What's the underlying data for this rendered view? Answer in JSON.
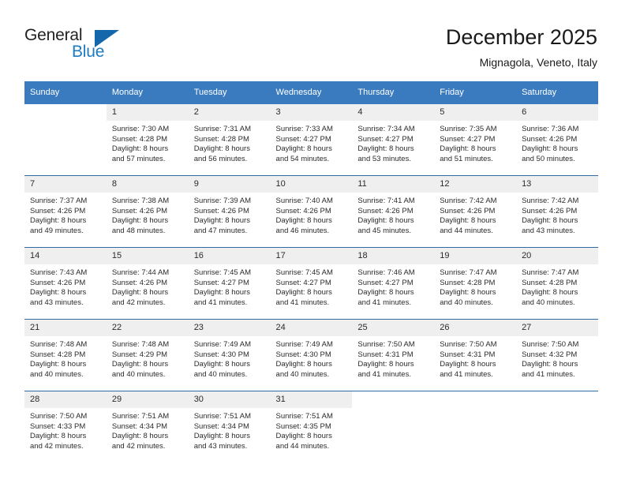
{
  "brand": {
    "name_part1": "General",
    "name_part2": "Blue",
    "triangle_color": "#1567ac",
    "blue_text_color": "#1f7ac0"
  },
  "header": {
    "title": "December 2025",
    "location": "Mignagola, Veneto, Italy"
  },
  "theme": {
    "header_row_bg": "#3a7bbf",
    "daynum_bg": "#efefef",
    "separator": "#2e6da4",
    "text": "#2b2b2b"
  },
  "weekdays": [
    "Sunday",
    "Monday",
    "Tuesday",
    "Wednesday",
    "Thursday",
    "Friday",
    "Saturday"
  ],
  "weeks": [
    [
      {
        "day": ""
      },
      {
        "day": "1",
        "sunrise": "Sunrise: 7:30 AM",
        "sunset": "Sunset: 4:28 PM",
        "daylight1": "Daylight: 8 hours",
        "daylight2": "and 57 minutes."
      },
      {
        "day": "2",
        "sunrise": "Sunrise: 7:31 AM",
        "sunset": "Sunset: 4:28 PM",
        "daylight1": "Daylight: 8 hours",
        "daylight2": "and 56 minutes."
      },
      {
        "day": "3",
        "sunrise": "Sunrise: 7:33 AM",
        "sunset": "Sunset: 4:27 PM",
        "daylight1": "Daylight: 8 hours",
        "daylight2": "and 54 minutes."
      },
      {
        "day": "4",
        "sunrise": "Sunrise: 7:34 AM",
        "sunset": "Sunset: 4:27 PM",
        "daylight1": "Daylight: 8 hours",
        "daylight2": "and 53 minutes."
      },
      {
        "day": "5",
        "sunrise": "Sunrise: 7:35 AM",
        "sunset": "Sunset: 4:27 PM",
        "daylight1": "Daylight: 8 hours",
        "daylight2": "and 51 minutes."
      },
      {
        "day": "6",
        "sunrise": "Sunrise: 7:36 AM",
        "sunset": "Sunset: 4:26 PM",
        "daylight1": "Daylight: 8 hours",
        "daylight2": "and 50 minutes."
      }
    ],
    [
      {
        "day": "7",
        "sunrise": "Sunrise: 7:37 AM",
        "sunset": "Sunset: 4:26 PM",
        "daylight1": "Daylight: 8 hours",
        "daylight2": "and 49 minutes."
      },
      {
        "day": "8",
        "sunrise": "Sunrise: 7:38 AM",
        "sunset": "Sunset: 4:26 PM",
        "daylight1": "Daylight: 8 hours",
        "daylight2": "and 48 minutes."
      },
      {
        "day": "9",
        "sunrise": "Sunrise: 7:39 AM",
        "sunset": "Sunset: 4:26 PM",
        "daylight1": "Daylight: 8 hours",
        "daylight2": "and 47 minutes."
      },
      {
        "day": "10",
        "sunrise": "Sunrise: 7:40 AM",
        "sunset": "Sunset: 4:26 PM",
        "daylight1": "Daylight: 8 hours",
        "daylight2": "and 46 minutes."
      },
      {
        "day": "11",
        "sunrise": "Sunrise: 7:41 AM",
        "sunset": "Sunset: 4:26 PM",
        "daylight1": "Daylight: 8 hours",
        "daylight2": "and 45 minutes."
      },
      {
        "day": "12",
        "sunrise": "Sunrise: 7:42 AM",
        "sunset": "Sunset: 4:26 PM",
        "daylight1": "Daylight: 8 hours",
        "daylight2": "and 44 minutes."
      },
      {
        "day": "13",
        "sunrise": "Sunrise: 7:42 AM",
        "sunset": "Sunset: 4:26 PM",
        "daylight1": "Daylight: 8 hours",
        "daylight2": "and 43 minutes."
      }
    ],
    [
      {
        "day": "14",
        "sunrise": "Sunrise: 7:43 AM",
        "sunset": "Sunset: 4:26 PM",
        "daylight1": "Daylight: 8 hours",
        "daylight2": "and 43 minutes."
      },
      {
        "day": "15",
        "sunrise": "Sunrise: 7:44 AM",
        "sunset": "Sunset: 4:26 PM",
        "daylight1": "Daylight: 8 hours",
        "daylight2": "and 42 minutes."
      },
      {
        "day": "16",
        "sunrise": "Sunrise: 7:45 AM",
        "sunset": "Sunset: 4:27 PM",
        "daylight1": "Daylight: 8 hours",
        "daylight2": "and 41 minutes."
      },
      {
        "day": "17",
        "sunrise": "Sunrise: 7:45 AM",
        "sunset": "Sunset: 4:27 PM",
        "daylight1": "Daylight: 8 hours",
        "daylight2": "and 41 minutes."
      },
      {
        "day": "18",
        "sunrise": "Sunrise: 7:46 AM",
        "sunset": "Sunset: 4:27 PM",
        "daylight1": "Daylight: 8 hours",
        "daylight2": "and 41 minutes."
      },
      {
        "day": "19",
        "sunrise": "Sunrise: 7:47 AM",
        "sunset": "Sunset: 4:28 PM",
        "daylight1": "Daylight: 8 hours",
        "daylight2": "and 40 minutes."
      },
      {
        "day": "20",
        "sunrise": "Sunrise: 7:47 AM",
        "sunset": "Sunset: 4:28 PM",
        "daylight1": "Daylight: 8 hours",
        "daylight2": "and 40 minutes."
      }
    ],
    [
      {
        "day": "21",
        "sunrise": "Sunrise: 7:48 AM",
        "sunset": "Sunset: 4:28 PM",
        "daylight1": "Daylight: 8 hours",
        "daylight2": "and 40 minutes."
      },
      {
        "day": "22",
        "sunrise": "Sunrise: 7:48 AM",
        "sunset": "Sunset: 4:29 PM",
        "daylight1": "Daylight: 8 hours",
        "daylight2": "and 40 minutes."
      },
      {
        "day": "23",
        "sunrise": "Sunrise: 7:49 AM",
        "sunset": "Sunset: 4:30 PM",
        "daylight1": "Daylight: 8 hours",
        "daylight2": "and 40 minutes."
      },
      {
        "day": "24",
        "sunrise": "Sunrise: 7:49 AM",
        "sunset": "Sunset: 4:30 PM",
        "daylight1": "Daylight: 8 hours",
        "daylight2": "and 40 minutes."
      },
      {
        "day": "25",
        "sunrise": "Sunrise: 7:50 AM",
        "sunset": "Sunset: 4:31 PM",
        "daylight1": "Daylight: 8 hours",
        "daylight2": "and 41 minutes."
      },
      {
        "day": "26",
        "sunrise": "Sunrise: 7:50 AM",
        "sunset": "Sunset: 4:31 PM",
        "daylight1": "Daylight: 8 hours",
        "daylight2": "and 41 minutes."
      },
      {
        "day": "27",
        "sunrise": "Sunrise: 7:50 AM",
        "sunset": "Sunset: 4:32 PM",
        "daylight1": "Daylight: 8 hours",
        "daylight2": "and 41 minutes."
      }
    ],
    [
      {
        "day": "28",
        "sunrise": "Sunrise: 7:50 AM",
        "sunset": "Sunset: 4:33 PM",
        "daylight1": "Daylight: 8 hours",
        "daylight2": "and 42 minutes."
      },
      {
        "day": "29",
        "sunrise": "Sunrise: 7:51 AM",
        "sunset": "Sunset: 4:34 PM",
        "daylight1": "Daylight: 8 hours",
        "daylight2": "and 42 minutes."
      },
      {
        "day": "30",
        "sunrise": "Sunrise: 7:51 AM",
        "sunset": "Sunset: 4:34 PM",
        "daylight1": "Daylight: 8 hours",
        "daylight2": "and 43 minutes."
      },
      {
        "day": "31",
        "sunrise": "Sunrise: 7:51 AM",
        "sunset": "Sunset: 4:35 PM",
        "daylight1": "Daylight: 8 hours",
        "daylight2": "and 44 minutes."
      },
      {
        "day": ""
      },
      {
        "day": ""
      },
      {
        "day": ""
      }
    ]
  ]
}
